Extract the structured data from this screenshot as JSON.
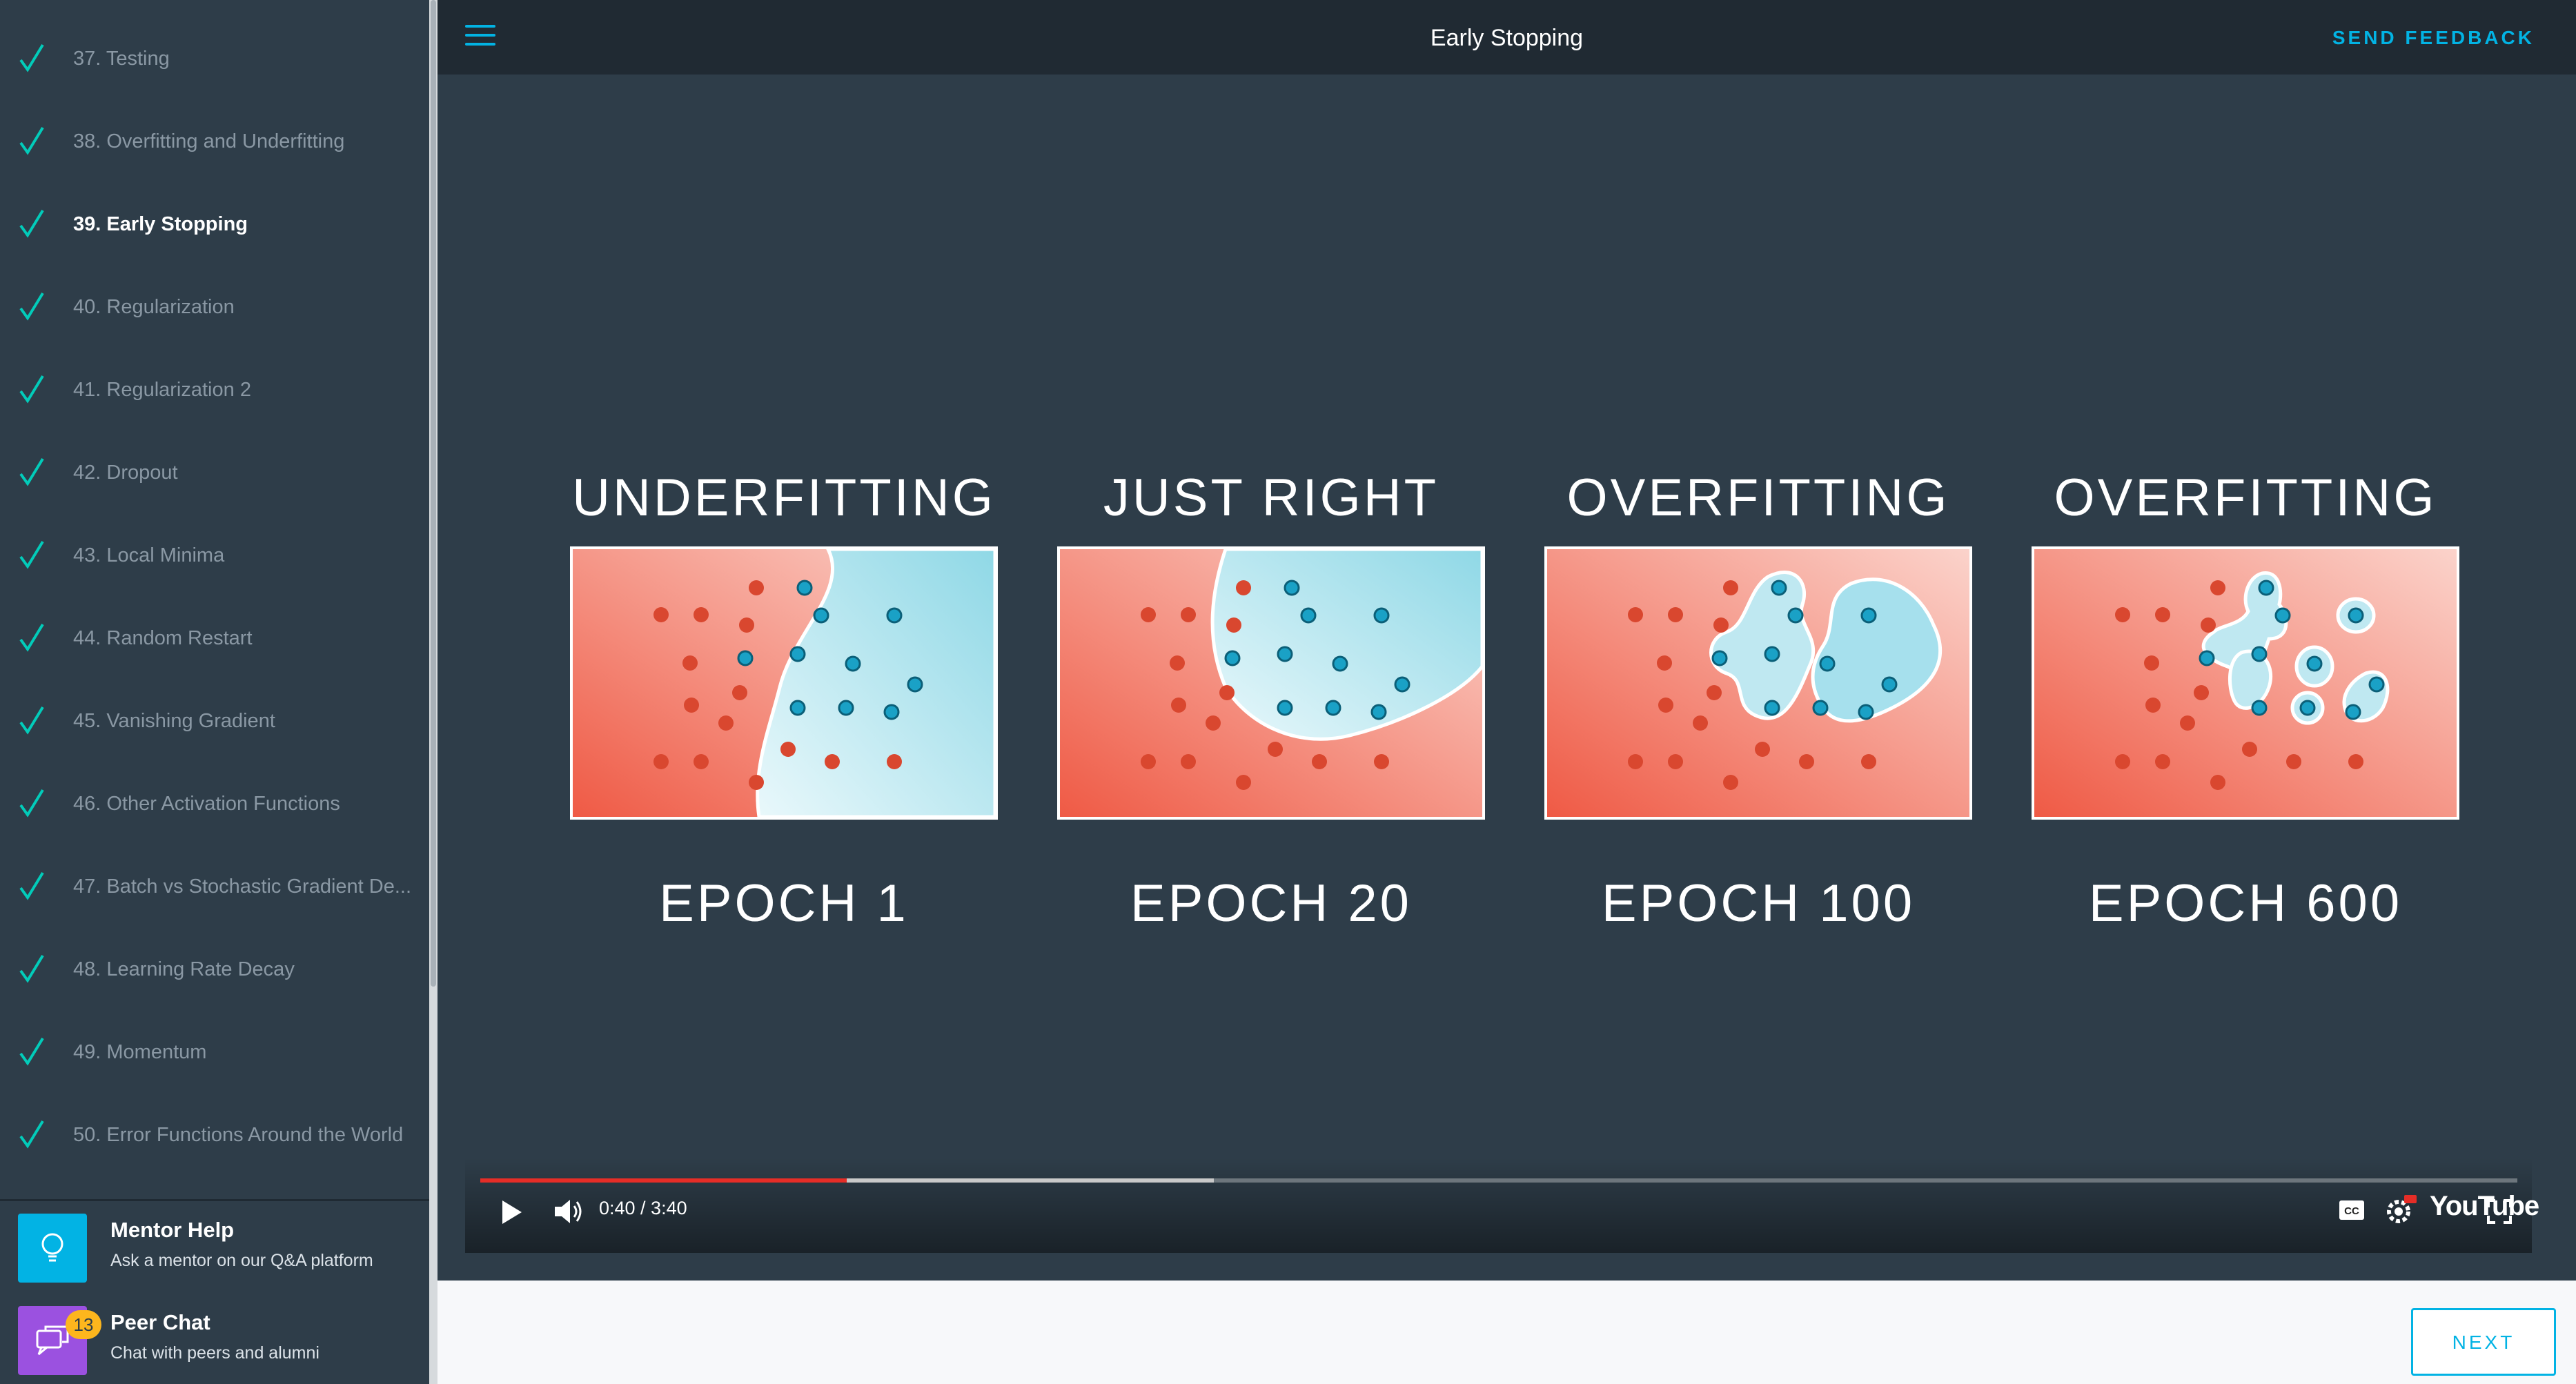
{
  "sidebar": {
    "items": [
      {
        "label": "37. Testing",
        "completed": true,
        "active": false
      },
      {
        "label": "38. Overfitting and Underfitting",
        "completed": true,
        "active": false
      },
      {
        "label": "39. Early Stopping",
        "completed": true,
        "active": true
      },
      {
        "label": "40. Regularization",
        "completed": true,
        "active": false
      },
      {
        "label": "41. Regularization 2",
        "completed": true,
        "active": false
      },
      {
        "label": "42. Dropout",
        "completed": true,
        "active": false
      },
      {
        "label": "43. Local Minima",
        "completed": true,
        "active": false
      },
      {
        "label": "44. Random Restart",
        "completed": true,
        "active": false
      },
      {
        "label": "45. Vanishing Gradient",
        "completed": true,
        "active": false
      },
      {
        "label": "46. Other Activation Functions",
        "completed": true,
        "active": false
      },
      {
        "label": "47. Batch vs Stochastic Gradient De...",
        "completed": true,
        "active": false
      },
      {
        "label": "48. Learning Rate Decay",
        "completed": true,
        "active": false
      },
      {
        "label": "49. Momentum",
        "completed": true,
        "active": false
      },
      {
        "label": "50. Error Functions Around the World",
        "completed": true,
        "active": false
      }
    ],
    "mentor_help": {
      "title": "Mentor Help",
      "subtitle": "Ask a mentor on our Q&A platform",
      "color": "#02b3e4",
      "icon": "lightbulb-icon"
    },
    "peer_chat": {
      "title": "Peer Chat",
      "subtitle": "Chat with peers and alumni",
      "badge": "13",
      "color": "#9b51e0",
      "icon": "chat-icon"
    }
  },
  "header": {
    "title": "Early Stopping",
    "feedback_label": "SEND FEEDBACK",
    "accent": "#02b3e4"
  },
  "video": {
    "panels": [
      {
        "title": "UNDERFITTING",
        "epoch": "EPOCH 1"
      },
      {
        "title": "JUST RIGHT",
        "epoch": "EPOCH 20"
      },
      {
        "title": "OVERFITTING",
        "epoch": "EPOCH 100"
      },
      {
        "title": "OVERFITTING",
        "epoch": "EPOCH 600"
      }
    ],
    "time": "0:40 / 3:40",
    "played_fraction": 0.18,
    "buffered_fraction": 0.36,
    "logo": "YouTube"
  },
  "footer": {
    "next_label": "NEXT"
  }
}
